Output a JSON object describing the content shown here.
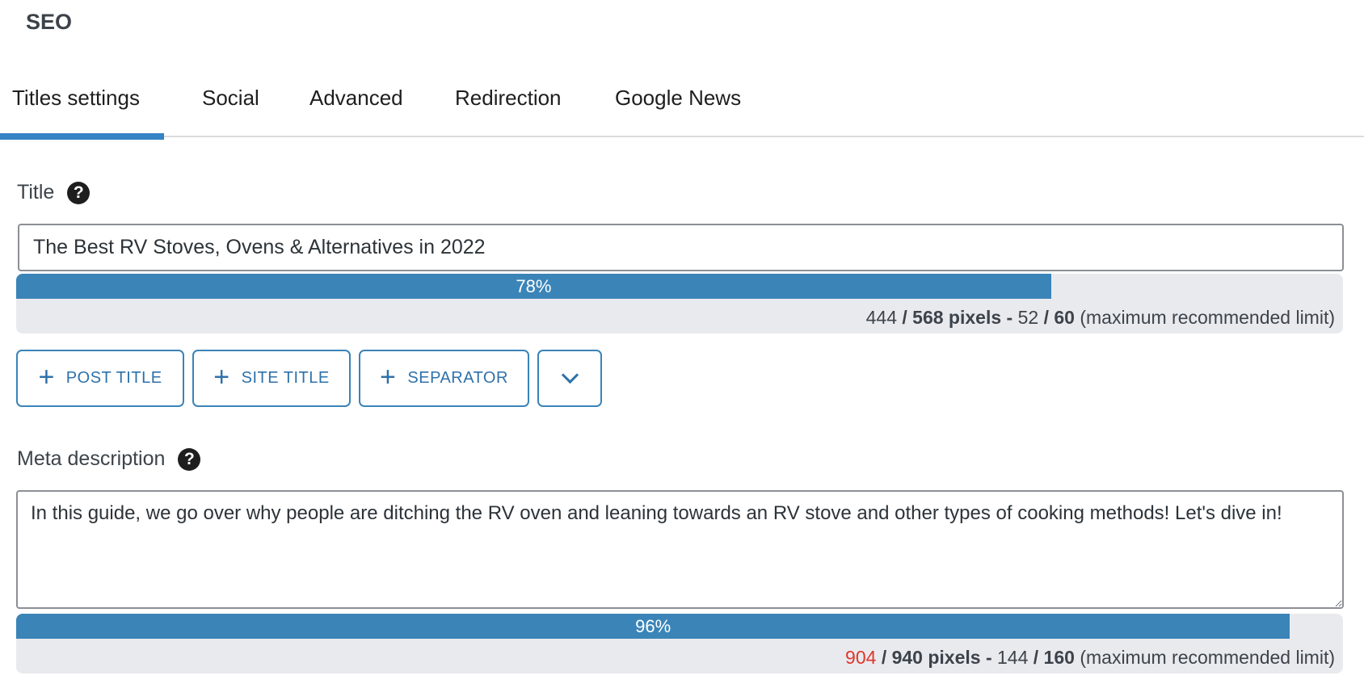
{
  "header": {
    "title": "SEO"
  },
  "tabs": [
    {
      "label": "Titles settings",
      "active": true
    },
    {
      "label": "Social",
      "active": false
    },
    {
      "label": "Advanced",
      "active": false
    },
    {
      "label": "Redirection",
      "active": false
    },
    {
      "label": "Google News",
      "active": false
    }
  ],
  "title_field": {
    "label": "Title",
    "help_icon": "question-circle-icon",
    "value": "The Best RV Stoves, Ovens & Alternatives in 2022",
    "meter": {
      "percent_value": 78,
      "percent_label": "78%",
      "pixels_used": "444",
      "pixels_max": "/ 568 pixels -",
      "chars_used": "52",
      "chars_max": "/ 60",
      "note": "(maximum recommended limit)"
    }
  },
  "tag_buttons": [
    {
      "icon": "plus-icon",
      "label": "POST TITLE"
    },
    {
      "icon": "plus-icon",
      "label": "SITE TITLE"
    },
    {
      "icon": "plus-icon",
      "label": "SEPARATOR"
    },
    {
      "icon": "chevron-down-icon",
      "label": ""
    }
  ],
  "description_field": {
    "label": "Meta description",
    "help_icon": "question-circle-icon",
    "value": "In this guide, we go over why people are ditching the RV oven and leaning towards an RV stove and other types of cooking methods! Let's dive in!",
    "meter": {
      "percent_value": 96,
      "percent_label": "96%",
      "pixels_used": "904",
      "pixels_used_color": "#e0362b",
      "pixels_max": "/ 940 pixels -",
      "chars_used": "144",
      "chars_max": "/ 160",
      "note": "(maximum recommended limit)"
    }
  },
  "colors": {
    "accent": "#3582c4",
    "meter_fill": "#3a84b8",
    "meter_bg": "#e9eaee",
    "warning": "#e0362b"
  }
}
